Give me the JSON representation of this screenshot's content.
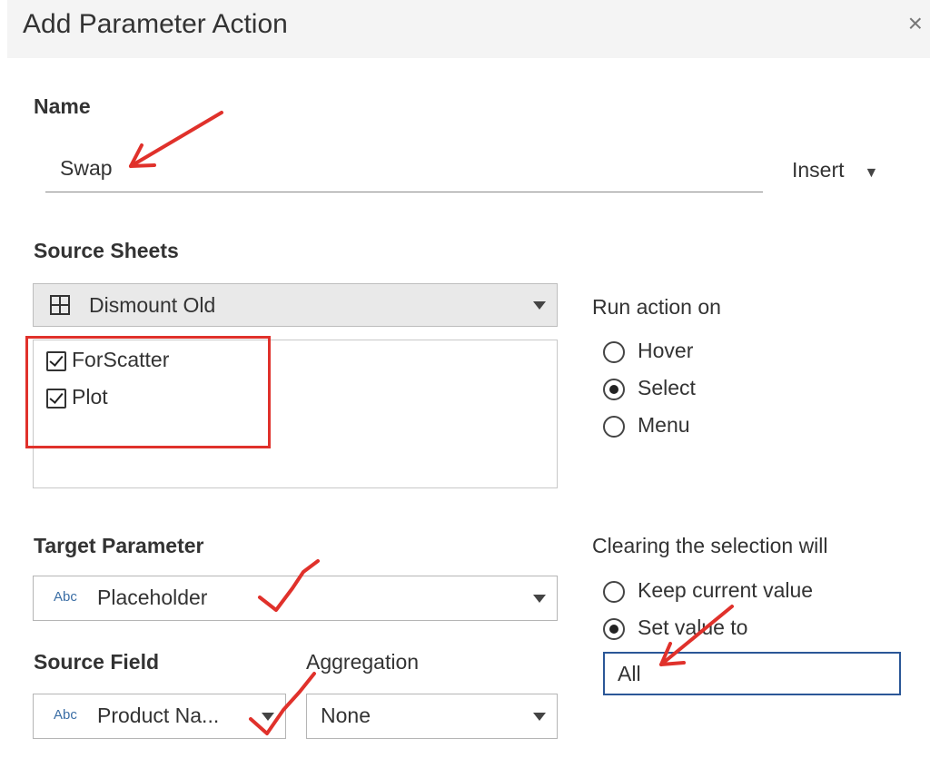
{
  "dialog": {
    "title": "Add Parameter Action",
    "close_symbol": "×"
  },
  "name": {
    "label": "Name",
    "value": "Swap",
    "insert_label": "Insert",
    "insert_caret": "▼"
  },
  "source_sheets": {
    "label": "Source Sheets",
    "selected": "Dismount Old",
    "sheets": [
      {
        "name": "ForScatter",
        "checked": true
      },
      {
        "name": "Plot",
        "checked": true
      }
    ]
  },
  "run_action_on": {
    "label": "Run action on",
    "options": [
      {
        "label": "Hover",
        "selected": false
      },
      {
        "label": "Select",
        "selected": true
      },
      {
        "label": "Menu",
        "selected": false
      }
    ]
  },
  "target_parameter": {
    "label": "Target Parameter",
    "type_badge": "Abc",
    "value": "Placeholder"
  },
  "source_field": {
    "label": "Source Field",
    "type_badge": "Abc",
    "value": "Product Na..."
  },
  "aggregation": {
    "label": "Aggregation",
    "value": "None"
  },
  "clearing": {
    "label": "Clearing the selection will",
    "options": [
      {
        "label": "Keep current value",
        "selected": false
      },
      {
        "label": "Set value to",
        "selected": true
      }
    ],
    "value": "All"
  },
  "colors": {
    "annotation": "#e0312b",
    "focus_border": "#2b5797",
    "badge": "#3b6ea5"
  }
}
